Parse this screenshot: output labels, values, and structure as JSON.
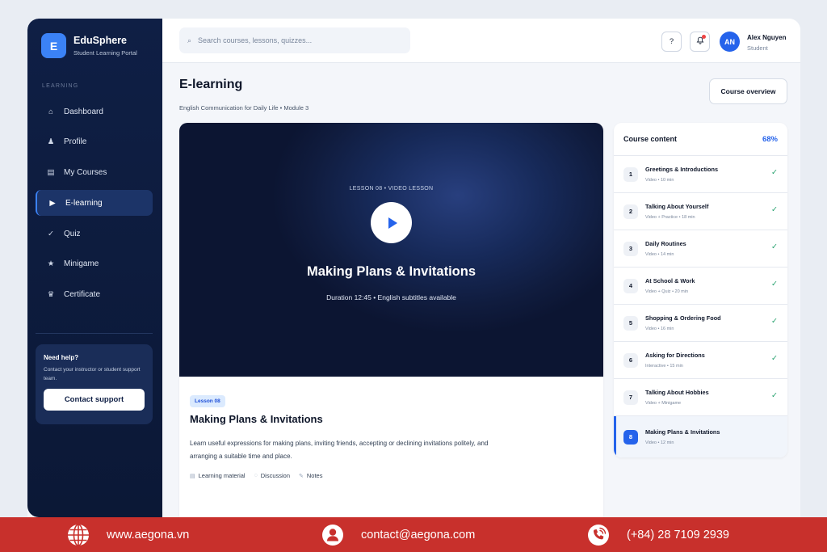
{
  "brand": {
    "logo_letter": "E",
    "name": "EduSphere",
    "subtitle": "Student Learning Portal"
  },
  "sidebar": {
    "section_label": "LEARNING",
    "items": [
      {
        "label": "Dashboard",
        "icon": "home-icon",
        "active": false
      },
      {
        "label": "Profile",
        "icon": "user-icon",
        "active": false
      },
      {
        "label": "My Courses",
        "icon": "courses-icon",
        "active": false
      },
      {
        "label": "E-learning",
        "icon": "play-icon",
        "active": true
      },
      {
        "label": "Quiz",
        "icon": "check-icon",
        "active": false
      },
      {
        "label": "Minigame",
        "icon": "star-icon",
        "active": false
      },
      {
        "label": "Certificate",
        "icon": "crown-icon",
        "active": false
      }
    ],
    "help": {
      "title": "Need help?",
      "text": "Contact your instructor or student support team.",
      "button": "Contact support"
    }
  },
  "topbar": {
    "search_placeholder": "Search courses, lessons, quizzes...",
    "help_icon": "?",
    "avatar_initials": "AN",
    "user_name": "Alex Nguyen",
    "user_role": "Student"
  },
  "page": {
    "title": "E-learning",
    "subtitle": "English Communication for Daily Life • Module 3",
    "overview_button": "Course overview"
  },
  "video": {
    "tag": "LESSON 08 • VIDEO LESSON",
    "title": "Making Plans & Invitations",
    "meta": "Duration 12:45 • English subtitles available"
  },
  "lesson": {
    "badge": "Lesson 08",
    "title": "Making Plans & Invitations",
    "description": "Learn useful expressions for making plans, inviting friends, accepting or declining invitations politely, and arranging a suitable time and place.",
    "links": [
      "Learning material",
      "Discussion",
      "Notes"
    ]
  },
  "course_content": {
    "title": "Course content",
    "progress": "68%",
    "items": [
      {
        "num": "1",
        "name": "Greetings & Introductions",
        "meta": "Video • 10 min",
        "done": true
      },
      {
        "num": "2",
        "name": "Talking About Yourself",
        "meta": "Video + Practice • 18 min",
        "done": true
      },
      {
        "num": "3",
        "name": "Daily Routines",
        "meta": "Video • 14 min",
        "done": true
      },
      {
        "num": "4",
        "name": "At School & Work",
        "meta": "Video + Quiz • 20 min",
        "done": true
      },
      {
        "num": "5",
        "name": "Shopping & Ordering Food",
        "meta": "Video • 16 min",
        "done": true
      },
      {
        "num": "6",
        "name": "Asking for Directions",
        "meta": "Interactive • 15 min",
        "done": true
      },
      {
        "num": "7",
        "name": "Talking About Hobbies",
        "meta": "Video + Minigame",
        "done": true
      },
      {
        "num": "8",
        "name": "Making Plans & Invitations",
        "meta": "Video • 12 min",
        "done": false,
        "current": true
      }
    ]
  },
  "footer": {
    "website": "www.aegona.vn",
    "email": "contact@aegona.com",
    "phone": "(+84) 28 7109 2939"
  },
  "colors": {
    "accent": "#2563eb",
    "sidebar": "#0f1f45",
    "footer": "#c8302c",
    "done": "#22a06b"
  }
}
